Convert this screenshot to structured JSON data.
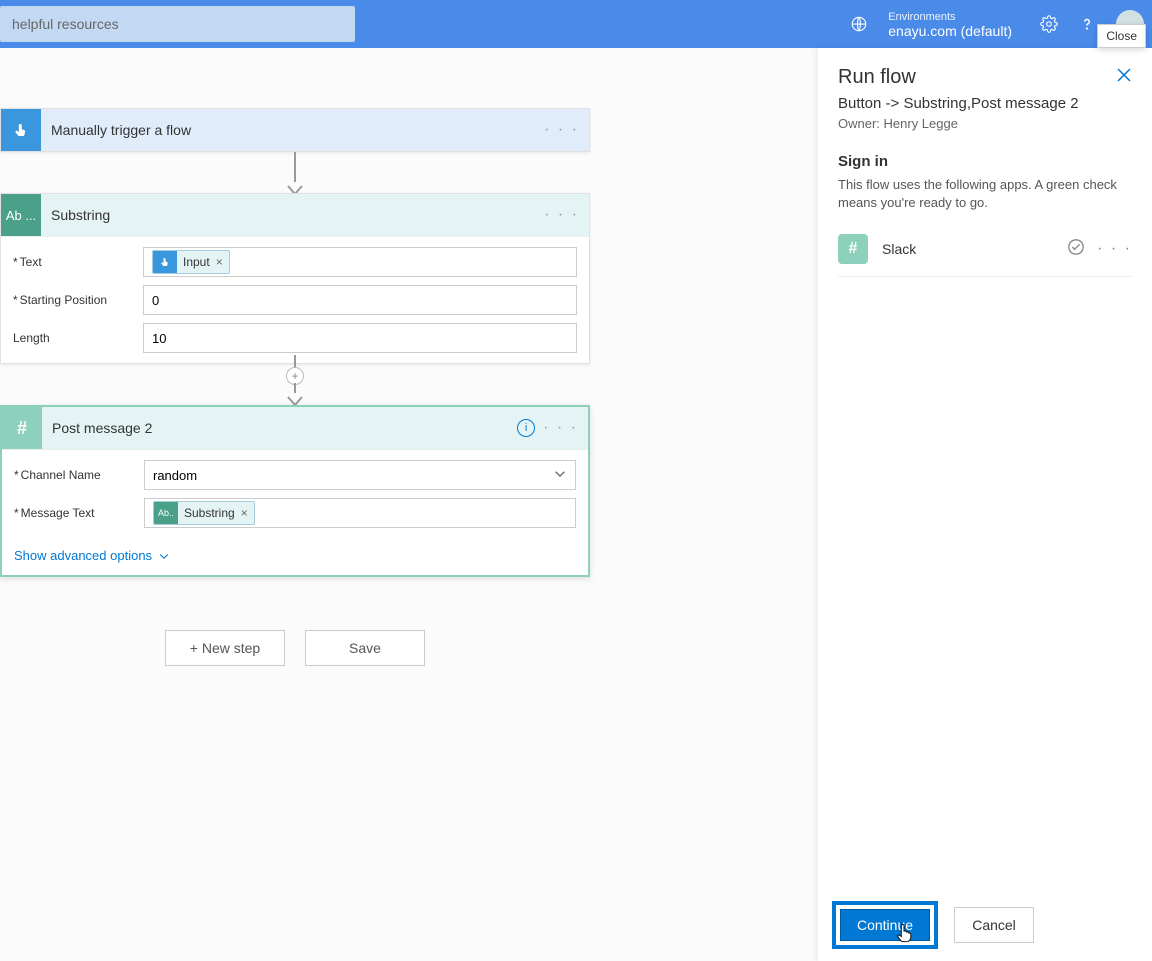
{
  "header": {
    "search_text": "helpful resources",
    "env_label": "Environments",
    "env_name": "enayu.com (default)"
  },
  "tooltip": {
    "close": "Close"
  },
  "trigger": {
    "title": "Manually trigger a flow"
  },
  "substring": {
    "title": "Substring",
    "text_label": "Text",
    "text_token": "Input",
    "start_label": "Starting Position",
    "start_value": "0",
    "length_label": "Length",
    "length_value": "10",
    "icon_text": "Ab ..."
  },
  "postmsg": {
    "title": "Post message 2",
    "channel_label": "Channel Name",
    "channel_value": "random",
    "msg_label": "Message Text",
    "msg_token": "Substring",
    "advanced": "Show advanced options"
  },
  "buttons": {
    "new_step": "+ New step",
    "save": "Save"
  },
  "panel": {
    "title": "Run flow",
    "subtitle": "Button -> Substring,Post message 2",
    "owner": "Owner: Henry Legge",
    "signin": "Sign in",
    "desc": "This flow uses the following apps. A green check means you're ready to go.",
    "connection": "Slack",
    "continue": "Continue",
    "cancel": "Cancel"
  },
  "icons": {
    "hash": "#"
  }
}
